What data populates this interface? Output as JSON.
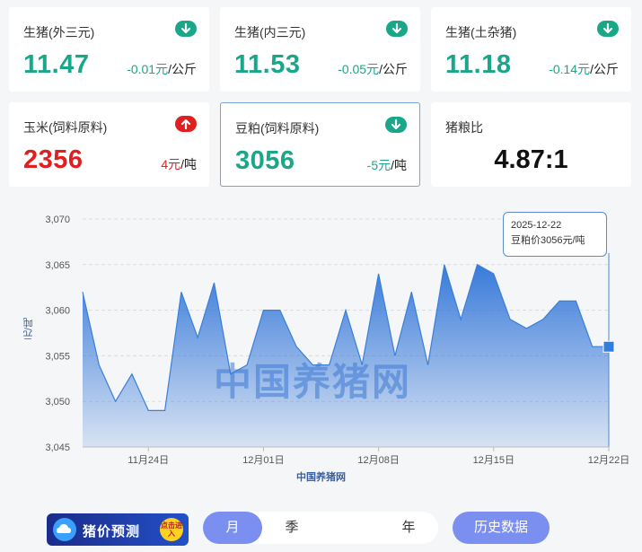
{
  "cards": [
    {
      "name": "生猪(外三元)",
      "price": "11.47",
      "change": "-0.01元",
      "unit": "/公斤",
      "trend": "down"
    },
    {
      "name": "生猪(内三元)",
      "price": "11.53",
      "change": "-0.05元",
      "unit": "/公斤",
      "trend": "down"
    },
    {
      "name": "生猪(土杂猪)",
      "price": "11.18",
      "change": "-0.14元",
      "unit": "/公斤",
      "trend": "down"
    },
    {
      "name": "玉米(饲料原料)",
      "price": "2356",
      "change": "4元",
      "unit": "/吨",
      "trend": "up"
    },
    {
      "name": "豆粕(饲料原料)",
      "price": "3056",
      "change": "-5元",
      "unit": "/吨",
      "trend": "down"
    },
    {
      "name": "猪粮比",
      "ratio": "4.87:1"
    }
  ],
  "colors": {
    "down": "#1aa688",
    "up": "#e02020",
    "accent": "#7b8ff0",
    "series": "#3b7fd9"
  },
  "chart_data": {
    "type": "area",
    "ylabel": "元/吨",
    "xlabel": "中国养猪网",
    "ylim": [
      3045,
      3070
    ],
    "yticks": [
      3045,
      3050,
      3055,
      3060,
      3065,
      3070
    ],
    "ytick_labels": [
      "3,045",
      "3,050",
      "3,055",
      "3,060",
      "3,065",
      "3,070"
    ],
    "xtick_labels": [
      "11月24日",
      "12月01日",
      "12月08日",
      "12月15日",
      "12月22日"
    ],
    "x": [
      "11-20",
      "11-21",
      "11-22",
      "11-23",
      "11-24",
      "11-25",
      "11-26",
      "11-27",
      "11-28",
      "11-29",
      "11-30",
      "12-01",
      "12-02",
      "12-03",
      "12-04",
      "12-05",
      "12-06",
      "12-07",
      "12-08",
      "12-09",
      "12-10",
      "12-11",
      "12-12",
      "12-13",
      "12-14",
      "12-15",
      "12-16",
      "12-17",
      "12-18",
      "12-19",
      "12-20",
      "12-21",
      "12-22"
    ],
    "values": [
      3062,
      3054,
      3050,
      3053,
      3049,
      3049,
      3062,
      3057,
      3063,
      3053,
      3054,
      3060,
      3060,
      3056,
      3054,
      3054,
      3060,
      3054,
      3064,
      3055,
      3062,
      3054,
      3065,
      3059,
      3065,
      3064,
      3059,
      3058,
      3059,
      3061,
      3061,
      3056,
      3056
    ],
    "grid": true,
    "tooltip": {
      "date": "2025-12-22",
      "text": "豆粕价3056元/吨"
    }
  },
  "watermark": "中国养猪网",
  "bottom": {
    "predict_label": "猪价预测",
    "predict_badge": "点击进入",
    "periods": [
      "月",
      "季",
      "年"
    ],
    "active_period": 0,
    "history_label": "历史数据"
  }
}
